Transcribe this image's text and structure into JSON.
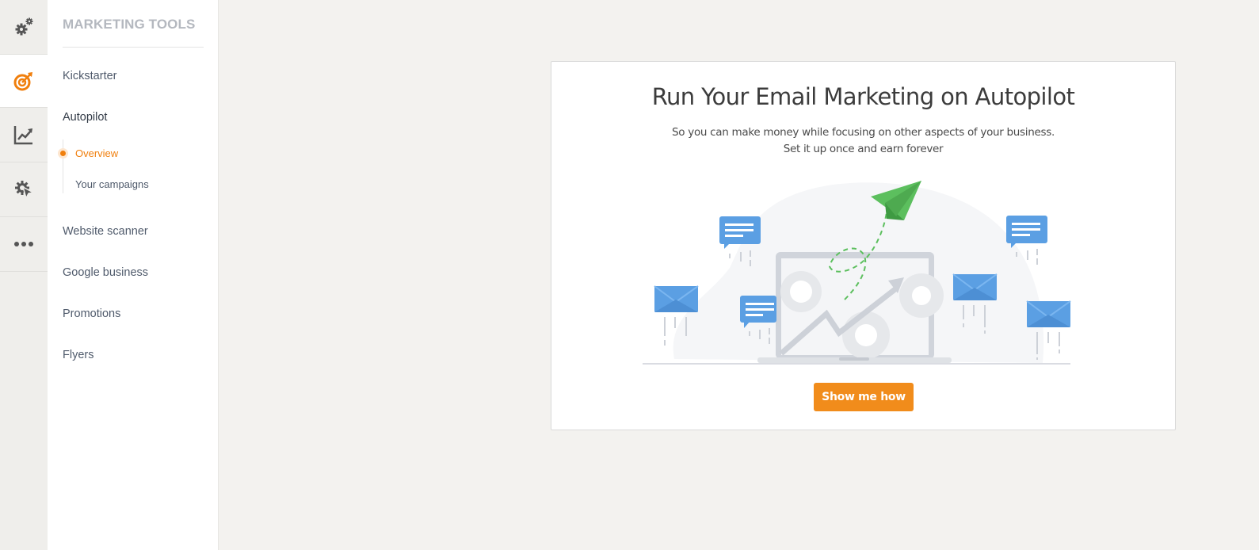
{
  "rail": {
    "items": [
      {
        "icon": "gears-icon",
        "active": false
      },
      {
        "icon": "target-icon",
        "active": true
      },
      {
        "icon": "chart-icon",
        "active": false
      },
      {
        "icon": "gear-cursor-icon",
        "active": false
      },
      {
        "icon": "more-icon",
        "active": false
      }
    ]
  },
  "sidebar": {
    "title": "MARKETING TOOLS",
    "items": [
      {
        "label": "Kickstarter"
      },
      {
        "label": "Autopilot"
      },
      {
        "label": "Website scanner"
      },
      {
        "label": "Google business"
      },
      {
        "label": "Promotions"
      },
      {
        "label": "Flyers"
      }
    ],
    "autopilot_sub": [
      {
        "label": "Overview",
        "active": true
      },
      {
        "label": "Your campaigns",
        "active": false
      }
    ]
  },
  "main": {
    "title": "Run Your Email Marketing on Autopilot",
    "subtitle_line1": "So you can make money while focusing on other aspects of your business.",
    "subtitle_line2": "Set it up once and earn forever",
    "cta_label": "Show me how"
  },
  "colors": {
    "accent": "#f07f0d",
    "button": "#f18c1b",
    "illustration_blue": "#5b9fe3",
    "plane_green": "#5cbf5e"
  }
}
